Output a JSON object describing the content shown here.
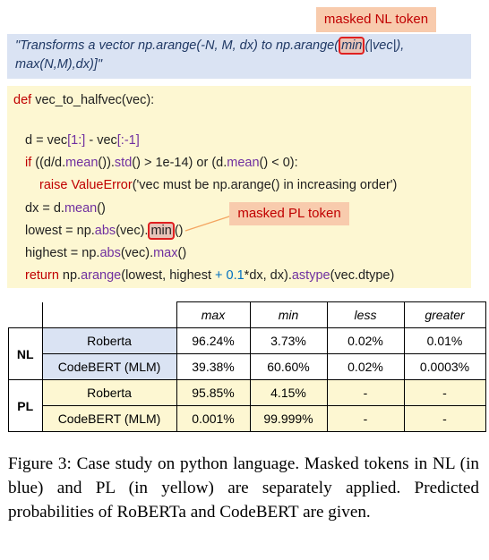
{
  "nl_badge": "masked NL token",
  "pl_badge": "masked PL token",
  "nl_text": {
    "before": "\"Transforms a vector np.arange(-N, M, dx) to np.arange(",
    "mask": "min",
    "after_line1": "(|vec|),",
    "line2": "max(N,M),dx)]\""
  },
  "code": {
    "l1_kw": "def",
    "l1_rest": " vec_to_halfvec(vec):",
    "l2_a": "d = vec",
    "l2_b": "[1:]",
    "l2_c": " - vec",
    "l2_d": "[:-1]",
    "l3_kw": "if",
    "l3_a": " ((d/d.",
    "l3_fn1": "mean",
    "l3_b": "()).",
    "l3_fn2": "std",
    "l3_c": "() > ",
    "l3_num1": "1e-14",
    "l3_d": ") or (d.",
    "l3_fn3": "mean",
    "l3_e": "() < ",
    "l3_num2": "0",
    "l3_f": "):",
    "l4_kw": "raise",
    "l4_err": " ValueError",
    "l4_rest": "('vec must be np.arange() in increasing order')",
    "l5_a": "dx = d.",
    "l5_fn": "mean",
    "l5_b": "()",
    "l6_a": "lowest = np.",
    "l6_fn": "abs",
    "l6_b": "(vec).",
    "l6_mask": "min",
    "l6_c": "()",
    "l7_a": "highest = np.",
    "l7_fn1": "abs",
    "l7_b": "(vec).",
    "l7_fn2": "max",
    "l7_c": "()",
    "l8_kw": "return",
    "l8_a": " np.",
    "l8_fn1": "arange",
    "l8_b": "(lowest, highest ",
    "l8_num": "+ 0.1",
    "l8_c": "*dx, dx).",
    "l8_fn2": "astype",
    "l8_d": "(vec.dtype)"
  },
  "table": {
    "headers": [
      "max",
      "min",
      "less",
      "greater"
    ],
    "nl_label": "NL",
    "pl_label": "PL",
    "rows": [
      {
        "model": "Roberta",
        "values": [
          "96.24%",
          "3.73%",
          "0.02%",
          "0.01%"
        ]
      },
      {
        "model": "CodeBERT (MLM)",
        "values": [
          "39.38%",
          "60.60%",
          "0.02%",
          "0.0003%"
        ]
      },
      {
        "model": "Roberta",
        "values": [
          "95.85%",
          "4.15%",
          "-",
          "-"
        ]
      },
      {
        "model": "CodeBERT (MLM)",
        "values": [
          "0.001%",
          "99.999%",
          "-",
          "-"
        ]
      }
    ]
  },
  "caption": "Figure 3: Case study on python language. Masked tokens in NL (in blue) and PL (in yellow) are separately applied. Predicted probabilities of RoBERTa and CodeBERT are given."
}
